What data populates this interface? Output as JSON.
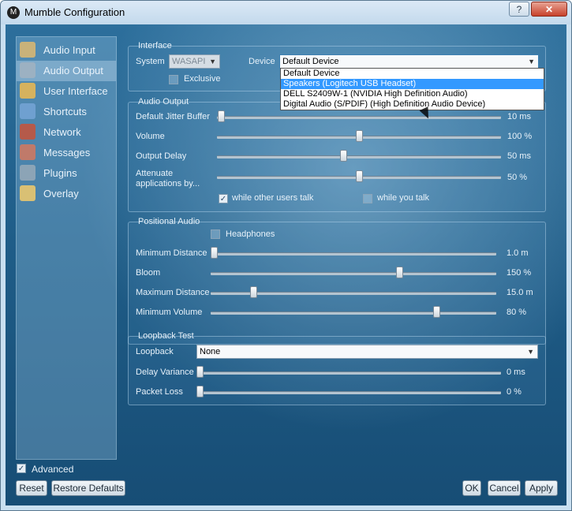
{
  "window": {
    "title": "Mumble Configuration",
    "help_label": "?",
    "close_label": "✕"
  },
  "sidebar": {
    "items": [
      {
        "label": "Audio Input",
        "icon": "microphone-icon",
        "color": "#c9b27a"
      },
      {
        "label": "Audio Output",
        "icon": "speaker-icon",
        "color": "#9cb1c2"
      },
      {
        "label": "User Interface",
        "icon": "user-interface-icon",
        "color": "#d6b25e"
      },
      {
        "label": "Shortcuts",
        "icon": "shortcuts-icon",
        "color": "#6fa0d0"
      },
      {
        "label": "Network",
        "icon": "network-icon",
        "color": "#b55a4a"
      },
      {
        "label": "Messages",
        "icon": "messages-icon",
        "color": "#c07a6a"
      },
      {
        "label": "Plugins",
        "icon": "plugins-icon",
        "color": "#8ca4b6"
      },
      {
        "label": "Overlay",
        "icon": "overlay-icon",
        "color": "#d9c074"
      }
    ],
    "selected_index": 1
  },
  "interface": {
    "title": "Interface",
    "system_label": "System",
    "system_value": "WASAPI",
    "device_label": "Device",
    "device_value": "Default Device",
    "exclusive_label": "Exclusive",
    "exclusive_checked": false,
    "dropdown_options": [
      "Default Device",
      "Speakers (Logitech USB Headset)",
      "DELL S2409W-1 (NVIDIA High Definition Audio)",
      "Digital Audio (S/PDIF) (High Definition Audio Device)"
    ],
    "dropdown_highlighted_index": 1
  },
  "audio_output": {
    "title": "Audio Output",
    "sliders": [
      {
        "label": "Default Jitter Buffer",
        "value": "10 ms",
        "fraction": 0.0
      },
      {
        "label": "Volume",
        "value": "100 %",
        "fraction": 0.5
      },
      {
        "label": "Output Delay",
        "value": "50 ms",
        "fraction": 0.42
      },
      {
        "label": "Attenuate applications by...",
        "value": "50 %",
        "fraction": 0.5
      }
    ],
    "while_other_users_talk_label": "while other users talk",
    "while_other_users_talk_checked": true,
    "while_you_talk_label": "while you talk",
    "while_you_talk_checked": false
  },
  "positional_audio": {
    "title": "Positional Audio",
    "headphones_label": "Headphones",
    "headphones_checked": false,
    "sliders": [
      {
        "label": "Minimum Distance",
        "value": "1.0 m",
        "fraction": 0.0
      },
      {
        "label": "Bloom",
        "value": "150 %",
        "fraction": 0.66
      },
      {
        "label": "Maximum Distance",
        "value": "15.0 m",
        "fraction": 0.15
      },
      {
        "label": "Minimum Volume",
        "value": "80 %",
        "fraction": 0.8
      }
    ]
  },
  "loopback": {
    "title": "Loopback Test",
    "loopback_label": "Loopback",
    "loopback_value": "None",
    "sliders": [
      {
        "label": "Delay Variance",
        "value": "0 ms",
        "fraction": 0.0
      },
      {
        "label": "Packet Loss",
        "value": "0 %",
        "fraction": 0.0
      }
    ]
  },
  "footer": {
    "advanced_label": "Advanced",
    "advanced_checked": true,
    "reset_label": "Reset",
    "restore_defaults_label": "Restore Defaults",
    "ok_label": "OK",
    "cancel_label": "Cancel",
    "apply_label": "Apply"
  }
}
